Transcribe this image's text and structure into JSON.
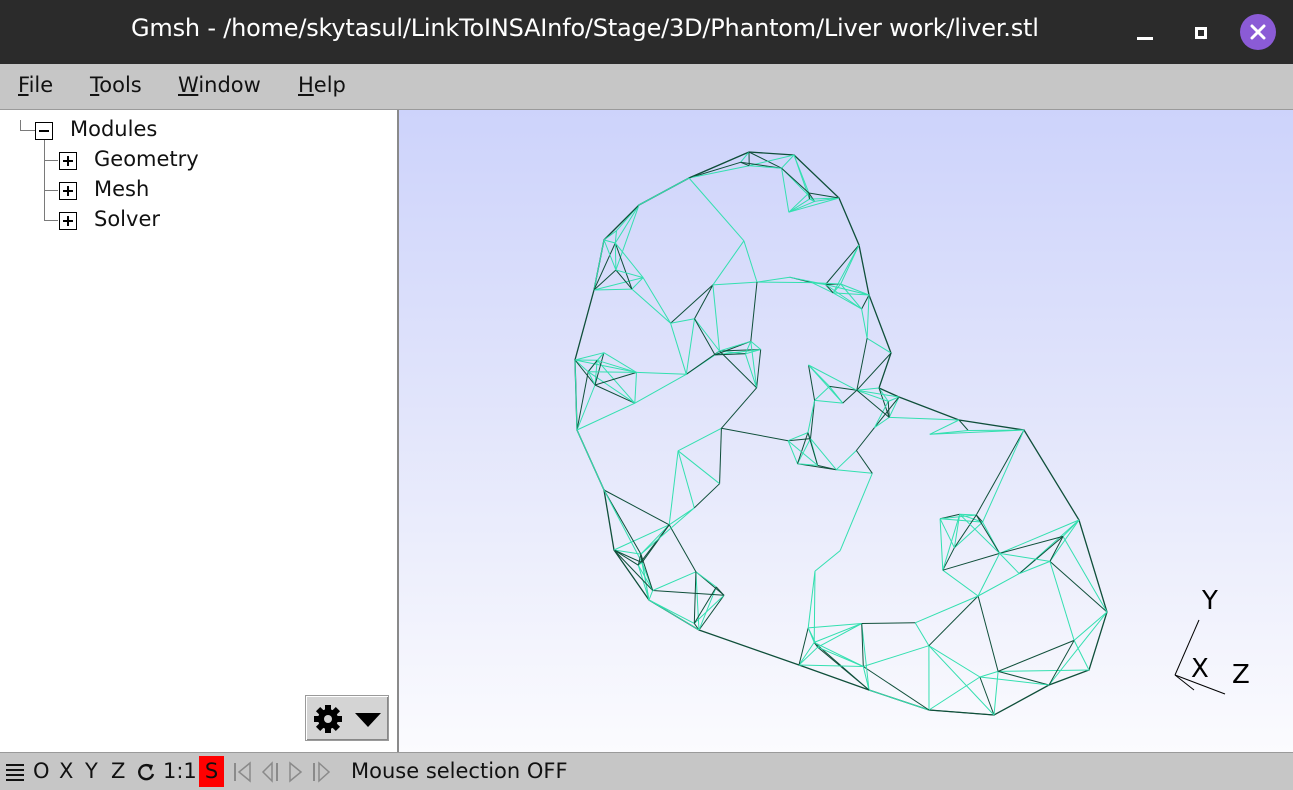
{
  "window": {
    "title": "Gmsh - /home/skytasul/LinkToINSAInfo/Stage/3D/Phantom/Liver work/liver.stl"
  },
  "menu": {
    "file": {
      "first": "F",
      "rest": "ile"
    },
    "tools": {
      "first": "T",
      "rest": "ools"
    },
    "window": {
      "first": "W",
      "rest": "indow"
    },
    "help": {
      "first": "H",
      "rest": "elp"
    }
  },
  "tree": {
    "root": "Modules",
    "children": [
      "Geometry",
      "Mesh",
      "Solver"
    ]
  },
  "axes": {
    "y": "Y",
    "x": "X",
    "z": "Z"
  },
  "statusbar": {
    "items": [
      "O",
      "X",
      "Y",
      "Z",
      "1:1",
      "S"
    ],
    "message": "Mouse selection OFF"
  },
  "colors": {
    "mesh_dark": "#0f4f3a",
    "mesh_light": "#33e0b0",
    "selection_red": "#ff0000",
    "close_button": "#8b5bd6"
  },
  "icons": [
    "minimize-icon",
    "maximize-icon",
    "close-icon",
    "gear-icon",
    "caret-down-icon",
    "hamburger-icon",
    "rotate-icon",
    "first-frame-icon",
    "step-back-icon",
    "play-icon",
    "step-forward-icon"
  ]
}
